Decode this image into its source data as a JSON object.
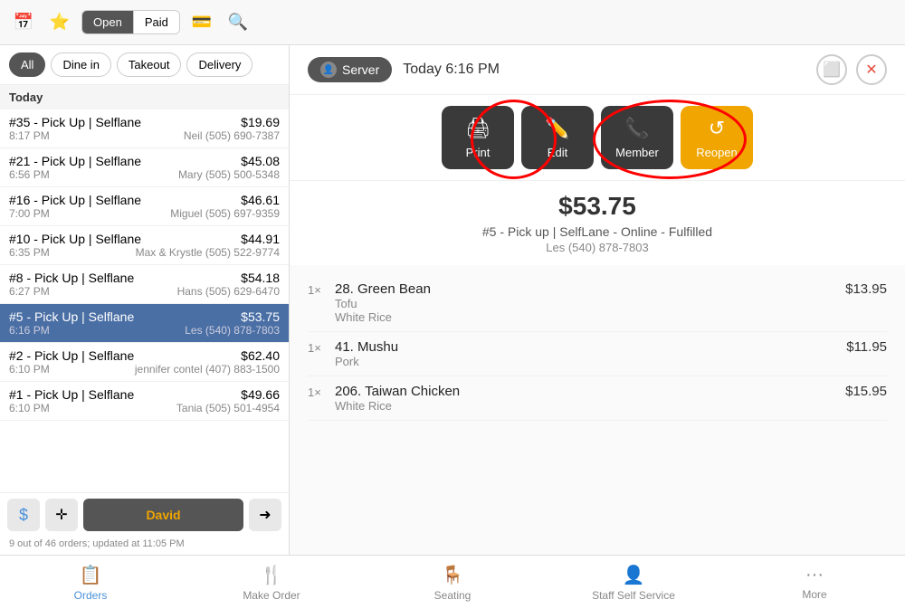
{
  "topBar": {
    "openLabel": "Open",
    "paidLabel": "Paid"
  },
  "filters": {
    "all": "All",
    "dineIn": "Dine in",
    "takeout": "Takeout",
    "delivery": "Delivery",
    "active": "All"
  },
  "sectionHeader": "Today",
  "orders": [
    {
      "id": "35",
      "label": "#35 - Pick Up | Selflane",
      "amount": "$19.69",
      "time": "8:17 PM",
      "customer": "Neil (505) 690-7387",
      "selected": false
    },
    {
      "id": "21",
      "label": "#21 - Pick Up | Selflane",
      "amount": "$45.08",
      "time": "6:56 PM",
      "customer": "Mary (505) 500-5348",
      "selected": false
    },
    {
      "id": "16",
      "label": "#16 - Pick Up | Selflane",
      "amount": "$46.61",
      "time": "7:00 PM",
      "customer": "Miguel (505) 697-9359",
      "selected": false
    },
    {
      "id": "10",
      "label": "#10 - Pick Up | Selflane",
      "amount": "$44.91",
      "time": "6:35 PM",
      "customer": "Max & Krystle (505) 522-9774",
      "selected": false
    },
    {
      "id": "8",
      "label": "#8 - Pick Up | Selflane",
      "amount": "$54.18",
      "time": "6:27 PM",
      "customer": "Hans (505) 629-6470",
      "selected": false
    },
    {
      "id": "5",
      "label": "#5 - Pick Up | Selflane",
      "amount": "$53.75",
      "time": "6:16 PM",
      "customer": "Les (540) 878-7803",
      "selected": true
    },
    {
      "id": "2",
      "label": "#2 - Pick Up | Selflane",
      "amount": "$62.40",
      "time": "6:10 PM",
      "customer": "jennifer contel (407) 883-1500",
      "selected": false
    },
    {
      "id": "1",
      "label": "#1 - Pick Up | Selflane",
      "amount": "$49.66",
      "time": "6:10 PM",
      "customer": "Tania (505) 501-4954",
      "selected": false
    }
  ],
  "serverName": "David",
  "sidebarStatus": "9 out of 46 orders; updated at 11:05 PM",
  "header": {
    "serverTag": "Server",
    "dateTime": "Today  6:16 PM"
  },
  "actionButtons": [
    {
      "icon": "🖨",
      "label": "Print",
      "style": "dark"
    },
    {
      "icon": "✏️",
      "label": "Edit",
      "style": "dark"
    },
    {
      "icon": "📞",
      "label": "Member",
      "style": "dark"
    },
    {
      "icon": "↺",
      "label": "Reopen",
      "style": "gold"
    }
  ],
  "orderDetail": {
    "total": "$53.75",
    "info": "#5 - Pick up | SelfLane - Online - Fulfilled",
    "customer": "Les (540) 878-7803",
    "items": [
      {
        "qty": "1×",
        "number": "28.",
        "name": "Green Bean",
        "modifiers": [
          "Tofu",
          "White Rice"
        ],
        "price": "$13.95"
      },
      {
        "qty": "1×",
        "number": "41.",
        "name": "Mushu",
        "modifiers": [
          "Pork"
        ],
        "price": "$11.95"
      },
      {
        "qty": "1×",
        "number": "206.",
        "name": "Taiwan  Chicken",
        "modifiers": [
          "White Rice"
        ],
        "price": "$15.95"
      }
    ]
  },
  "bottomNav": [
    {
      "icon": "📋",
      "label": "Orders",
      "active": true
    },
    {
      "icon": "🍴",
      "label": "Make Order",
      "active": false
    },
    {
      "icon": "🪑",
      "label": "Seating",
      "active": false
    },
    {
      "icon": "👤",
      "label": "Staff Self Service",
      "active": false
    },
    {
      "icon": "···",
      "label": "More",
      "active": false
    }
  ]
}
